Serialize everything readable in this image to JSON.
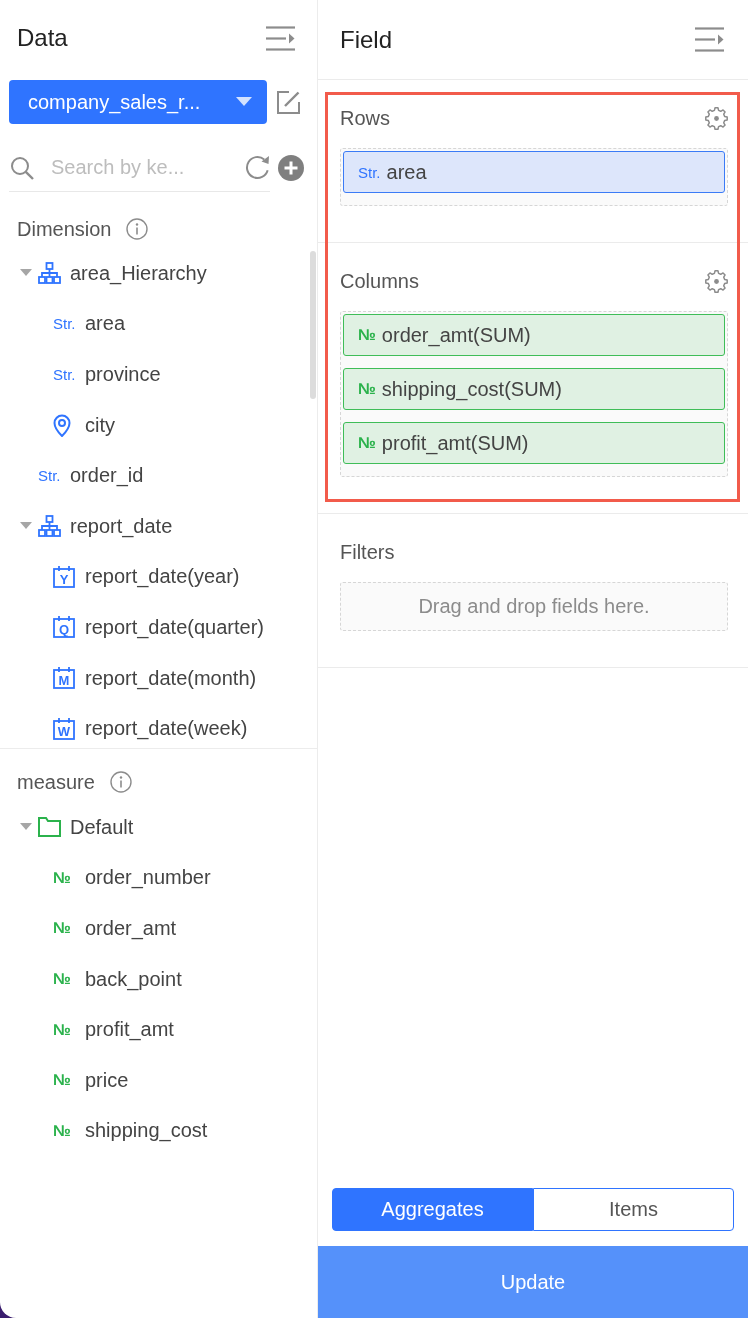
{
  "data_panel": {
    "title": "Data",
    "dataset": {
      "value": "company_sales_r..."
    },
    "search": {
      "placeholder": "Search by ke..."
    }
  },
  "dimension": {
    "title": "Dimension",
    "items": [
      {
        "label": "area_Hierarchy",
        "kind": "hierarchy",
        "expanded": true,
        "children": [
          {
            "label": "area",
            "kind": "string",
            "badge": "Str."
          },
          {
            "label": "province",
            "kind": "string",
            "badge": "Str."
          },
          {
            "label": "city",
            "kind": "geo"
          }
        ]
      },
      {
        "label": "order_id",
        "kind": "string",
        "badge": "Str."
      },
      {
        "label": "report_date",
        "kind": "hierarchy",
        "expanded": true,
        "children": [
          {
            "label": "report_date(year)",
            "kind": "date",
            "badge": "Y"
          },
          {
            "label": "report_date(quarter)",
            "kind": "date",
            "badge": "Q"
          },
          {
            "label": "report_date(month)",
            "kind": "date",
            "badge": "M"
          },
          {
            "label": "report_date(week)",
            "kind": "date",
            "badge": "W"
          }
        ]
      }
    ]
  },
  "measure": {
    "title": "measure",
    "items": [
      {
        "label": "Default",
        "kind": "folder",
        "expanded": true,
        "children": [
          {
            "label": "order_number",
            "kind": "number",
            "badge": "№"
          },
          {
            "label": "order_amt",
            "kind": "number",
            "badge": "№"
          },
          {
            "label": "back_point",
            "kind": "number",
            "badge": "№"
          },
          {
            "label": "profit_amt",
            "kind": "number",
            "badge": "№"
          },
          {
            "label": "price",
            "kind": "number",
            "badge": "№"
          },
          {
            "label": "shipping_cost",
            "kind": "number",
            "badge": "№"
          }
        ]
      }
    ]
  },
  "field_panel": {
    "title": "Field",
    "sections": [
      {
        "title": "Rows",
        "kind": "axis",
        "highlighted": true,
        "fields": [
          {
            "label": "area",
            "kind": "string",
            "badge": "Str."
          }
        ]
      },
      {
        "title": "Columns",
        "kind": "axis",
        "highlighted": true,
        "fields": [
          {
            "label": "order_amt(SUM)",
            "kind": "number",
            "badge": "№"
          },
          {
            "label": "shipping_cost(SUM)",
            "kind": "number",
            "badge": "№"
          },
          {
            "label": "profit_amt(SUM)",
            "kind": "number",
            "badge": "№"
          }
        ]
      },
      {
        "title": "Filters",
        "kind": "filter",
        "highlighted": false,
        "empty_hint": "Drag and drop fields here."
      }
    ]
  },
  "mode_toggle": [
    {
      "label": "Aggregates",
      "selected": true
    },
    {
      "label": "Items",
      "selected": false
    }
  ],
  "update_button": {
    "label": "Update"
  }
}
